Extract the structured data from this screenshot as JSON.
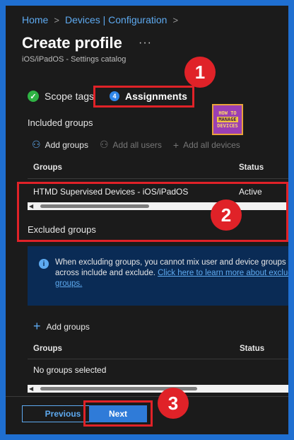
{
  "breadcrumb": {
    "home": "Home",
    "sep1": ">",
    "devices": "Devices | Configuration",
    "sep2": ">"
  },
  "page": {
    "title": "Create profile",
    "more": "···",
    "subtitle": "iOS/iPadOS - Settings catalog"
  },
  "tabs": [
    {
      "label": "Scope tags",
      "icon": "checkmark-icon",
      "icon_glyph": "✓"
    },
    {
      "label": "Assignments",
      "step": "4",
      "active": true
    }
  ],
  "logo": {
    "line1": "HOW TO",
    "line2": "MANAGE",
    "line3": "DEVICES"
  },
  "annotations": {
    "one": "1",
    "two": "2",
    "three": "3"
  },
  "included": {
    "heading": "Included groups",
    "actions": [
      {
        "label": "Add groups",
        "glyph": "⚇",
        "enabled": true
      },
      {
        "label": "Add all users",
        "glyph": "⚇",
        "enabled": false
      },
      {
        "label": "Add all devices",
        "glyph": "+",
        "enabled": false
      }
    ],
    "columns": {
      "groups": "Groups",
      "status": "Status"
    },
    "rows": [
      {
        "group": "HTMD Supervised Devices - iOS/iPadOS",
        "status": "Active"
      }
    ]
  },
  "excluded": {
    "heading": "Excluded groups",
    "info": {
      "line1": "When excluding groups, you cannot mix user and device groups",
      "line2_text": "across include and exclude. ",
      "link_a": "Click here to learn more about excludi",
      "link_b": "groups."
    },
    "add": {
      "glyph": "+",
      "label": "Add groups"
    },
    "columns": {
      "groups": "Groups",
      "status": "Status"
    },
    "empty": "No groups selected"
  },
  "footer": {
    "previous": "Previous",
    "next": "Next"
  },
  "colors": {
    "accent_red": "#e02228",
    "link_blue": "#5eaaf0",
    "primary_blue": "#2f7bd8",
    "frame_blue": "#1f6fd1",
    "background": "#1b1b1b"
  }
}
